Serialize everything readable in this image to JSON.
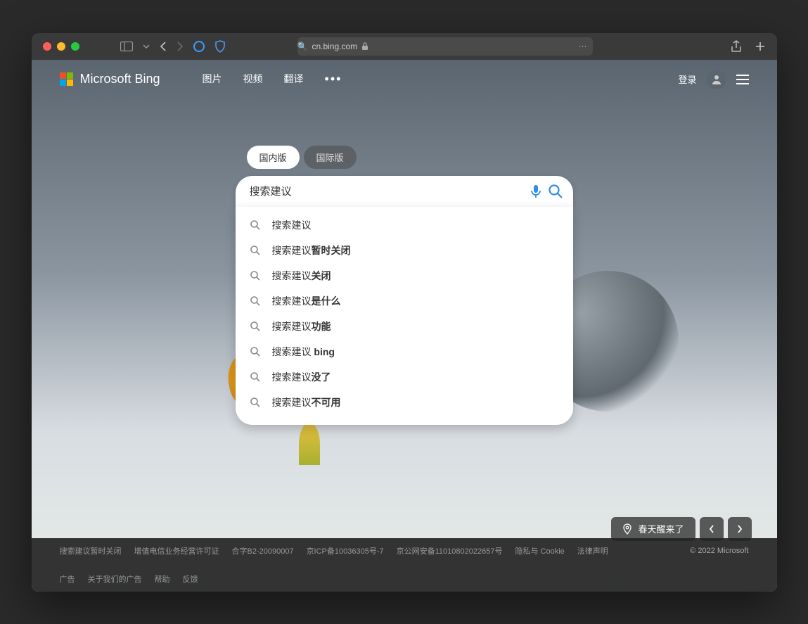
{
  "browser": {
    "url": "cn.bing.com"
  },
  "header": {
    "logo_text": "Microsoft Bing",
    "nav": [
      "图片",
      "视频",
      "翻译"
    ],
    "login": "登录"
  },
  "search": {
    "scope_tabs": {
      "domestic": "国内版",
      "international": "国际版"
    },
    "query": "搜索建议",
    "suggestions": [
      {
        "prefix": "搜索建议",
        "suffix": ""
      },
      {
        "prefix": "搜索建议",
        "suffix": "暂时关闭"
      },
      {
        "prefix": "搜索建议",
        "suffix": "关闭"
      },
      {
        "prefix": "搜索建议",
        "suffix": "是什么"
      },
      {
        "prefix": "搜索建议",
        "suffix": "功能"
      },
      {
        "prefix": "搜索建议",
        "suffix": " bing"
      },
      {
        "prefix": "搜索建议",
        "suffix": "没了"
      },
      {
        "prefix": "搜索建议",
        "suffix": "不可用"
      }
    ]
  },
  "bottom_info": {
    "caption": "春天醒来了"
  },
  "footer": {
    "links_row1": [
      "搜索建议暂时关闭",
      "增值电信业务经营许可证",
      "合字B2-20090007",
      "京ICP备10036305号-7",
      "京公网安备11010802022657号",
      "隐私与 Cookie",
      "法律声明"
    ],
    "copyright": "© 2022 Microsoft",
    "links_row2": [
      "广告",
      "关于我们的广告",
      "帮助",
      "反馈"
    ]
  }
}
